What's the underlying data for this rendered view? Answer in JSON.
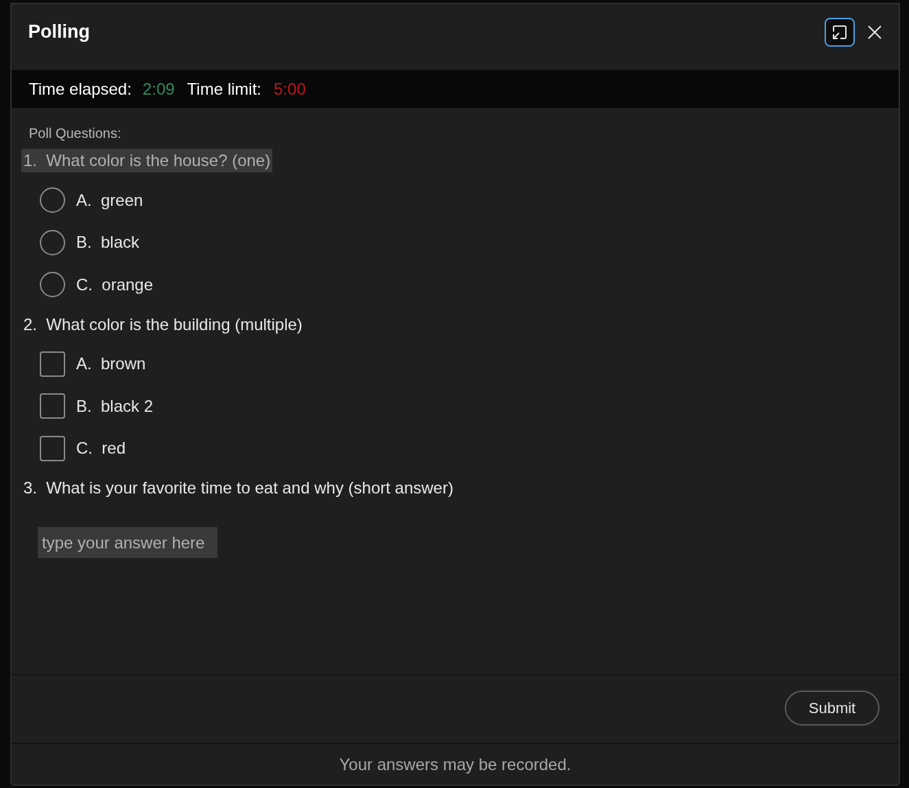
{
  "window": {
    "title": "Polling"
  },
  "timer": {
    "elapsed_label": "Time elapsed:",
    "elapsed": "2:09",
    "limit_label": "Time limit:",
    "limit": "5:00"
  },
  "section_label": "Poll Questions:",
  "questions": [
    {
      "number": "1.",
      "text": "What color is the house? (one)",
      "kind": "single",
      "highlighted": true,
      "options": [
        {
          "letter": "A.",
          "text": "green",
          "selected": false
        },
        {
          "letter": "B.",
          "text": "black",
          "selected": false
        },
        {
          "letter": "C.",
          "text": "orange",
          "selected": false
        }
      ]
    },
    {
      "number": "2.",
      "text": "What color is the building (multiple)",
      "kind": "multiple",
      "highlighted": false,
      "options": [
        {
          "letter": "A.",
          "text": "brown",
          "checked": false
        },
        {
          "letter": "B.",
          "text": "black 2",
          "checked": false
        },
        {
          "letter": "C.",
          "text": "red",
          "checked": false
        }
      ]
    },
    {
      "number": "3.",
      "text": "What is your favorite time to eat and why (short answer)",
      "kind": "text",
      "highlighted": false,
      "placeholder": "type your answer here"
    }
  ],
  "submit": "Submit",
  "notice": "Your answers may be recorded."
}
